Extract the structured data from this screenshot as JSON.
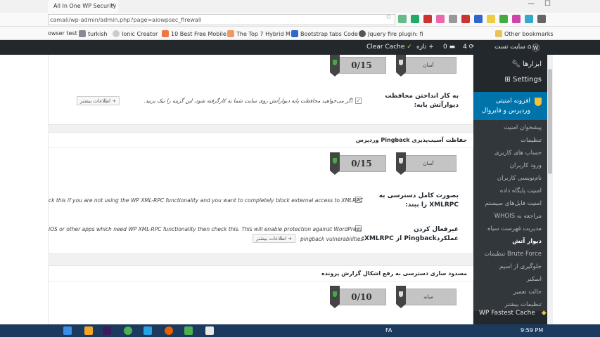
{
  "browser": {
    "tab_title": "All In One WP Security &",
    "url": "camali/wp-admin/admin.php?page=aiowpsec_firewall",
    "bookmarks": [
      "owser test",
      "turkish",
      "Ionic Creator",
      "10 Best Free Mobile",
      "The Top 7 Hybrid M",
      "Bootstrap tabs Code",
      "Jquery fire plugin: fi",
      "Other bookmarks"
    ]
  },
  "adminbar": {
    "site_name": "سایت تست",
    "updates_count": "4",
    "comments_count": "0",
    "new_label": "تازه",
    "clear_cache": "Clear Cache"
  },
  "sidebar": {
    "tools": "ابزارها",
    "settings": "Settings",
    "active_menu": "افزونه امنیتی وردپرس و فایروال",
    "items": [
      "پیشخوان امنیت",
      "تنظیمات",
      "حساب های کاربری",
      "ورود کاربران",
      "نام‌نویسی کاربران",
      "امنیت پایگاه داده",
      "امنیت فایل‌های سیستم",
      "مراجعه به WHOIS",
      "مدیریت فهرست سیاه",
      "دیوار آتش",
      "Brute Force تنظیمات",
      "جلوگیری از اسپم",
      "اسکنر",
      "حالت تعمیر",
      "تنظیمات بیشتر"
    ],
    "current_item": "دیوار آتش",
    "fastest_cache": "WP Fastest Cache"
  },
  "content": {
    "section1": {
      "score": "0/15",
      "level": "آسان",
      "label": "به کار انداختن محافظت دیوارآتش پایه:",
      "description": "اگر می‌خواهید محافظت پایه دیوارآتش روی سایت شما به کارگرفته شود، این گزینه را تیک بزنید.",
      "more_info": "+ اطلاعات بیشتر"
    },
    "section2": {
      "heading": "حفاظت آسیب‌پذیری Pingback وردپرس",
      "score": "0/15",
      "level": "آسان",
      "xmlrpc_label_line1": "بصورت کامل دسترسی به",
      "xmlrpc_label_line2": "XMLRPC را ببند:",
      "xmlrpc_desc": "ck this if you are not using the WP XML-RPC functionality and you want to completely block external access to XMLRPC",
      "pingback_label_line1": "غیرفعال کردن",
      "pingback_label_line2": "عملکردPingback از XMLRPC:",
      "pingback_desc_line1": "iOS or other apps which need WP XML-RPC functionality then check this. This will enable protection against WordPress",
      "pingback_desc_line2": "pingback vulnerabilities.",
      "more_info": "+ اطلاعات بیشتر"
    },
    "section3": {
      "heading": "مسدود سازی دسترسی به رفع اشکال گزارش پرونده",
      "score": "0/10",
      "level": "میانه"
    }
  },
  "taskbar": {
    "lang": "FA",
    "time": "9:59 PM"
  },
  "colors": {
    "wp_dark": "#23282d",
    "wp_blue": "#0073aa",
    "badge_gray": "#c4c4c4",
    "ribbon_green": "#3a7d3a",
    "ribbon_dark": "#444444"
  }
}
